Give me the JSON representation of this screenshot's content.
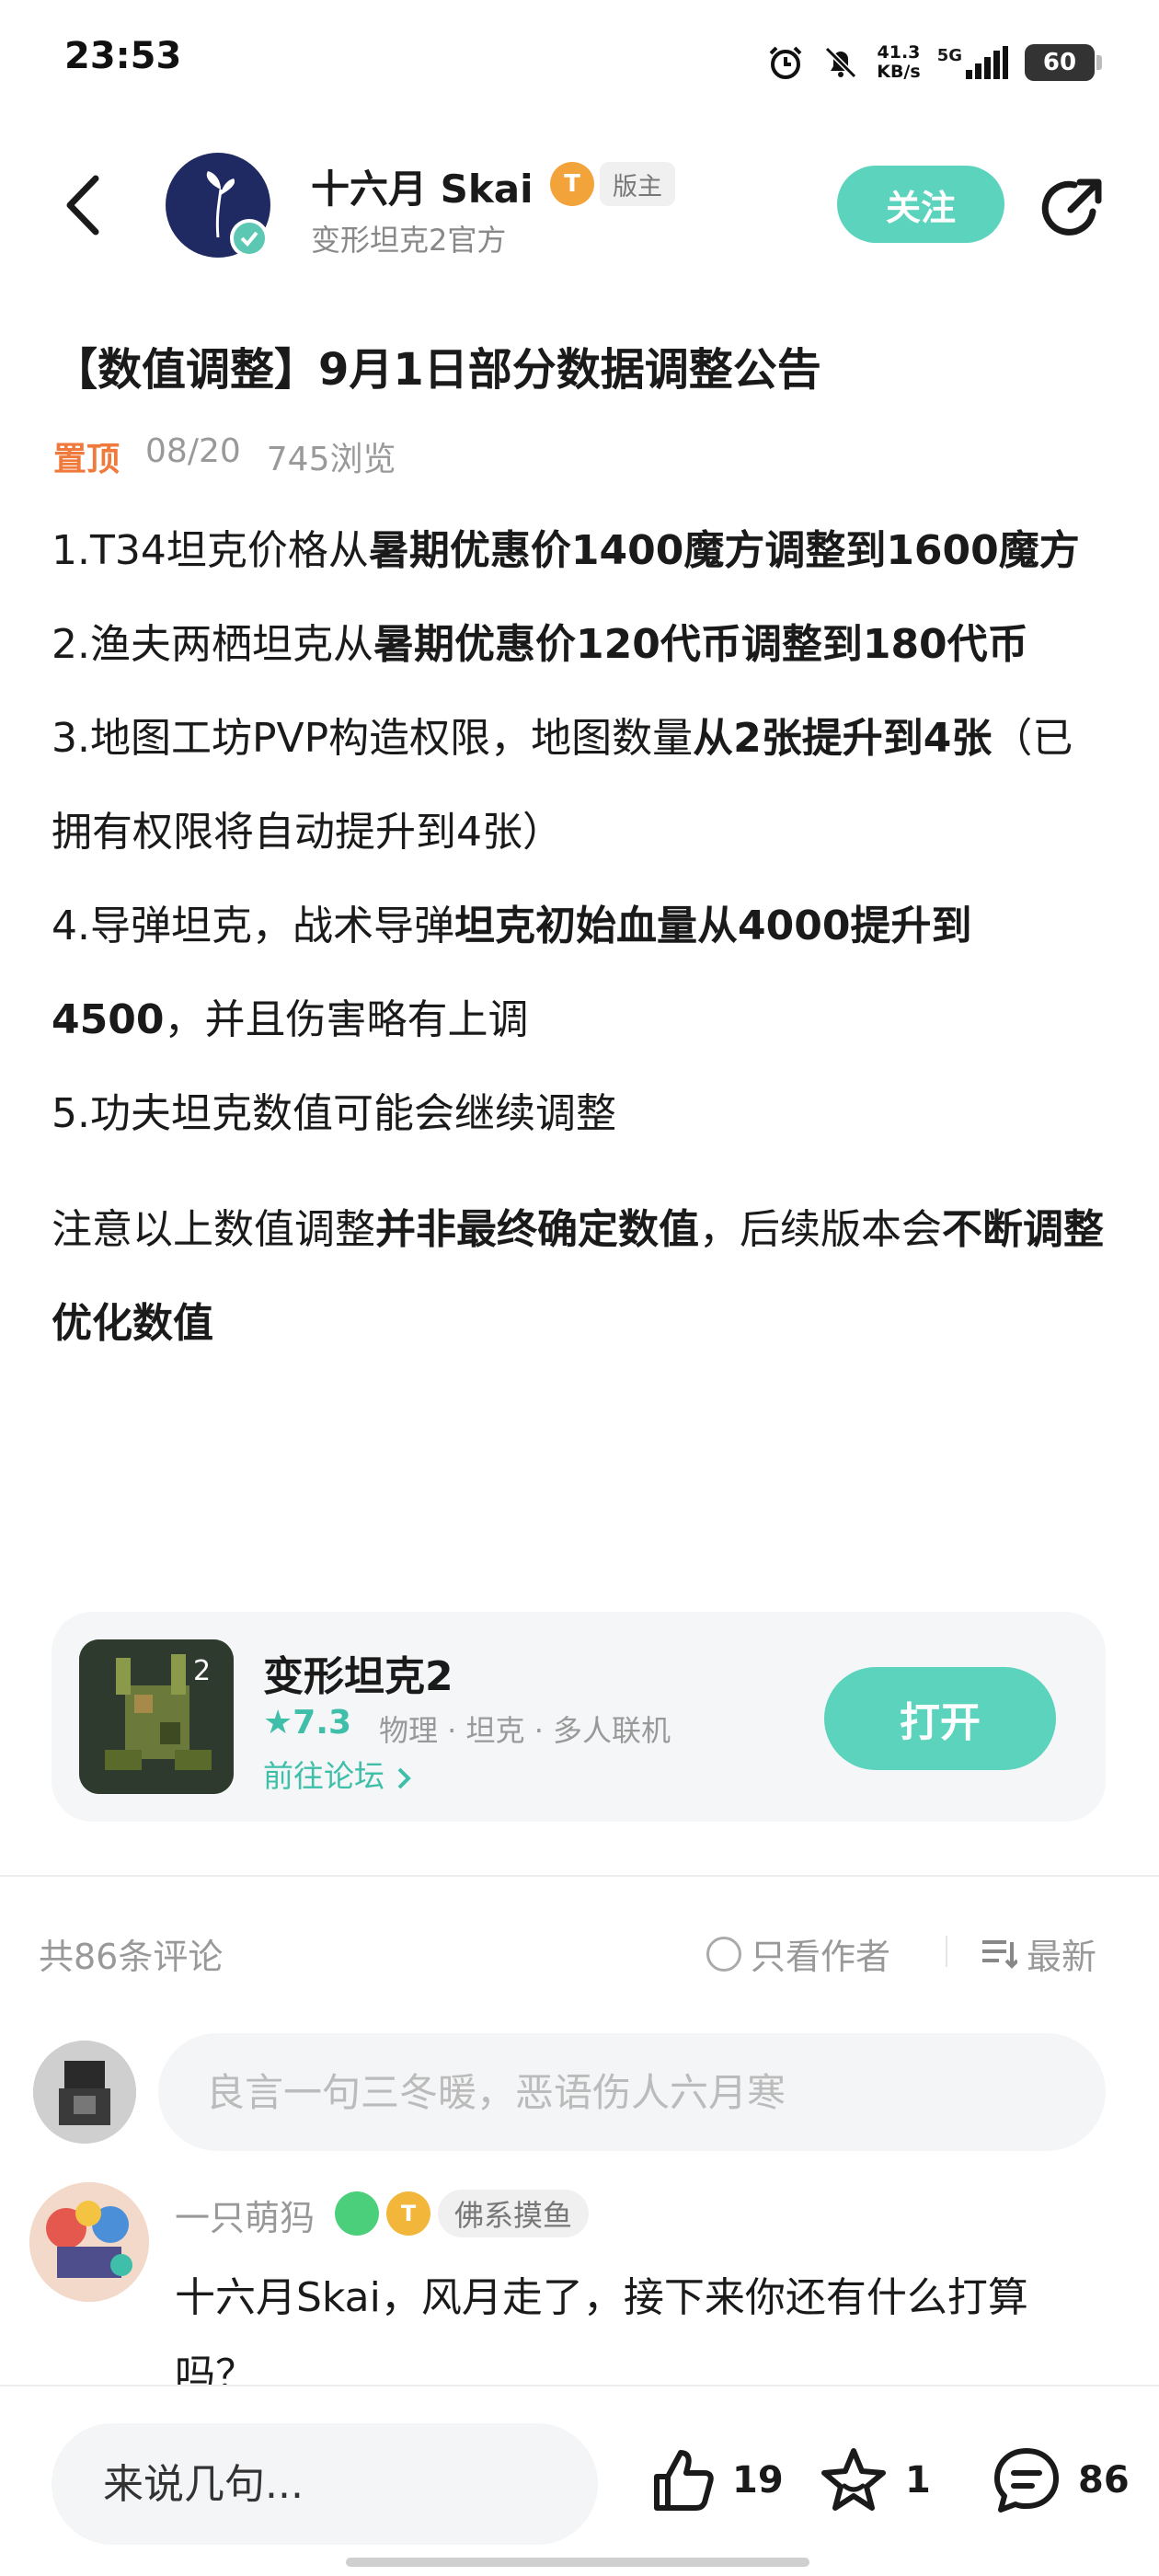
{
  "status_bar": {
    "time": "23:53",
    "net_speed_value": "41.3",
    "net_speed_unit": "KB/s",
    "network": "5G",
    "battery": "60",
    "icons": [
      "alarm-icon",
      "mute-bell-icon",
      "signal-icon",
      "battery-icon"
    ]
  },
  "header": {
    "author_name": "十六月 Skai",
    "level_badge": "T",
    "role_tag": "版主",
    "author_subtitle": "变形坦克2官方",
    "follow_label": "关注"
  },
  "post": {
    "title": "【数值调整】9月1日部分数据调整公告",
    "pin_label": "置顶",
    "date": "08/20",
    "views": "745浏览",
    "items": [
      {
        "pre": "1.T34坦克价格从",
        "bold": "暑期优惠价1400魔方调整到1600魔方",
        "post": ""
      },
      {
        "pre": "2.渔夫两栖坦克从",
        "bold": "暑期优惠价120代币调整到180代币",
        "post": ""
      },
      {
        "pre": "3.地图工坊PVP构造权限，地图数量",
        "bold": "从2张提升到4张",
        "post": "（已拥有权限将自动提升到4张）"
      },
      {
        "pre": "4.导弹坦克，战术导弹",
        "bold": "坦克初始血量从4000提升到4500",
        "post": "，并且伤害略有上调"
      },
      {
        "pre": "5.功夫坦克数值可能会继续调整",
        "bold": "",
        "post": ""
      }
    ],
    "note": {
      "p1": "注意以上数值调整",
      "b1": "并非最终确定数值",
      "p2": "，后续版本会",
      "b2": "不断调整优化数值"
    }
  },
  "game_card": {
    "name": "变形坦克2",
    "rating": "7.3",
    "tags": "物理 · 坦克 · 多人联机",
    "forum_link": "前往论坛",
    "open_label": "打开",
    "accent_color": "#5cd3bd"
  },
  "comments": {
    "count_label": "共86条评论",
    "author_only_label": "只看作者",
    "sort_label": "最新",
    "input_placeholder": "良言一句三冬暖，恶语伤人六月寒",
    "list": [
      {
        "username": "一只萌犸",
        "level_badge": "T",
        "tag": "佛系摸鱼",
        "text": "十六月Skai，风月走了，接下来你还有什么打算吗？"
      }
    ]
  },
  "bottom_bar": {
    "reply_placeholder": "来说几句...",
    "likes": "19",
    "favorites": "1",
    "comments": "86"
  }
}
